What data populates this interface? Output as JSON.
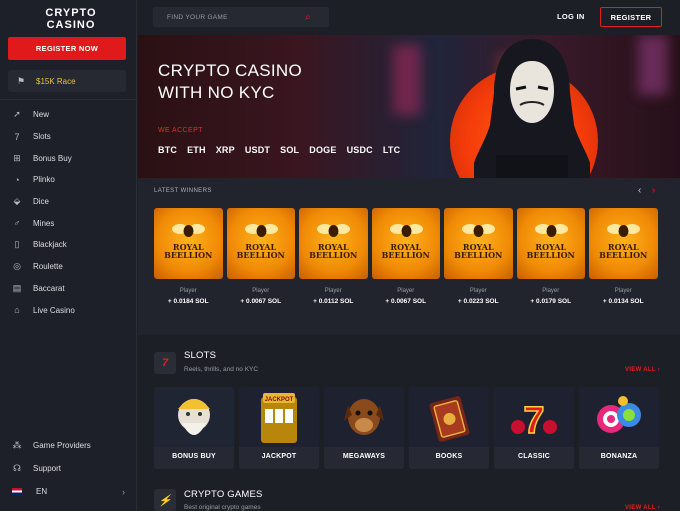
{
  "brand": {
    "logo_line1": "CRYPTO",
    "logo_line2": "CASINO"
  },
  "sidebar": {
    "register_label": "REGISTER NOW",
    "race_label": "$15K Race",
    "items": [
      {
        "label": "New",
        "icon": "rocket-icon"
      },
      {
        "label": "Slots",
        "icon": "seven-icon"
      },
      {
        "label": "Bonus Buy",
        "icon": "gift-icon"
      },
      {
        "label": "Plinko",
        "icon": "plinko-icon"
      },
      {
        "label": "Dice",
        "icon": "dice-icon"
      },
      {
        "label": "Mines",
        "icon": "mine-icon"
      },
      {
        "label": "Blackjack",
        "icon": "cards-icon"
      },
      {
        "label": "Roulette",
        "icon": "roulette-icon"
      },
      {
        "label": "Baccarat",
        "icon": "baccarat-icon"
      },
      {
        "label": "Live Casino",
        "icon": "live-icon"
      }
    ],
    "bottom": {
      "providers": "Game Providers",
      "support": "Support",
      "language": "EN"
    }
  },
  "header": {
    "search_placeholder": "FIND YOUR GAME",
    "login_label": "LOG IN",
    "register_label": "REGISTER"
  },
  "hero": {
    "title_line1": "CRYPTO CASINO",
    "title_line2": "WITH NO KYC",
    "accept_label": "WE ACCEPT",
    "coins": [
      "BTC",
      "ETH",
      "XRP",
      "USDT",
      "SOL",
      "DOGE",
      "USDC",
      "LTC"
    ]
  },
  "winners": {
    "title": "LATEST WINNERS",
    "game_logo": [
      "ROYAL",
      "BEELLION"
    ],
    "items": [
      {
        "player": "Player",
        "amount": "+ 0.0184 SOL"
      },
      {
        "player": "Player",
        "amount": "+ 0.0067 SOL"
      },
      {
        "player": "Player",
        "amount": "+ 0.0112 SOL"
      },
      {
        "player": "Player",
        "amount": "+ 0.0067 SOL"
      },
      {
        "player": "Player",
        "amount": "+ 0.0223 SOL"
      },
      {
        "player": "Player",
        "amount": "+ 0.0179 SOL"
      },
      {
        "player": "Player",
        "amount": "+ 0.0134 SOL"
      }
    ]
  },
  "slots": {
    "title": "SLOTS",
    "subtitle": "Reels, thrills, and no KYC",
    "view_all": "VIEW ALL",
    "games": [
      "BONUS BUY",
      "JACKPOT",
      "MEGAWAYS",
      "BOOKS",
      "CLASSIC",
      "BONANZA"
    ]
  },
  "crypto_games": {
    "title": "CRYPTO GAMES",
    "subtitle": "Best original crypto games",
    "view_all": "VIEW ALL"
  },
  "colors": {
    "accent": "#e01a1a",
    "background": "#1d1f27",
    "gold": "#f0c040"
  }
}
